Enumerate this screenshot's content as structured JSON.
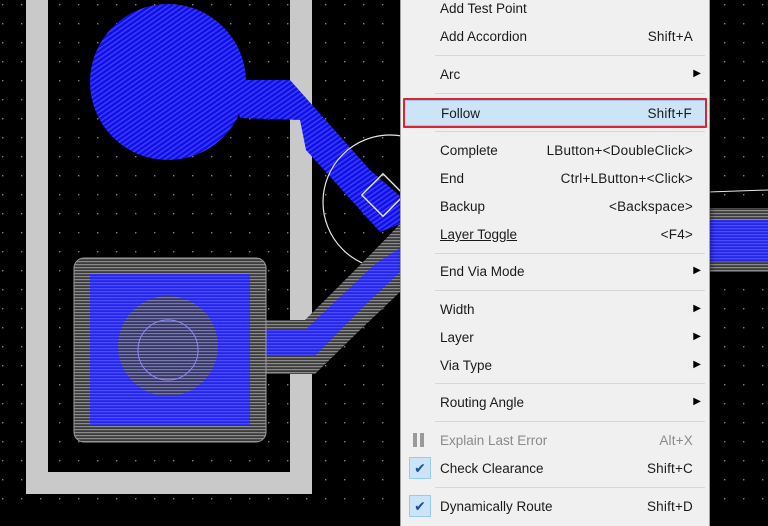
{
  "menu": {
    "items": [
      {
        "id": "add-test-point",
        "label": "Add Test Point",
        "shortcut": ""
      },
      {
        "id": "add-accordion",
        "label": "Add Accordion",
        "shortcut": "Shift+A"
      },
      {
        "id": "arc",
        "label": "Arc",
        "shortcut": "",
        "submenu": true
      },
      {
        "id": "follow",
        "label": "Follow",
        "shortcut": "Shift+F",
        "highlighted": true
      },
      {
        "id": "complete",
        "label": "Complete",
        "shortcut": "LButton+<DoubleClick>"
      },
      {
        "id": "end",
        "label": "End",
        "shortcut": "Ctrl+LButton+<Click>"
      },
      {
        "id": "backup",
        "label": "Backup",
        "shortcut": "<Backspace>"
      },
      {
        "id": "layer-toggle",
        "label": "Layer Toggle",
        "shortcut": "<F4>"
      },
      {
        "id": "end-via-mode",
        "label": "End Via Mode",
        "shortcut": "",
        "submenu": true
      },
      {
        "id": "width",
        "label": "Width",
        "shortcut": "",
        "submenu": true
      },
      {
        "id": "layer",
        "label": "Layer",
        "shortcut": "",
        "submenu": true
      },
      {
        "id": "via-type",
        "label": "Via Type",
        "shortcut": "",
        "submenu": true
      },
      {
        "id": "routing-angle",
        "label": "Routing Angle",
        "shortcut": "",
        "submenu": true
      },
      {
        "id": "explain-last-error",
        "label": "Explain Last Error",
        "shortcut": "Alt+X",
        "disabled": true
      },
      {
        "id": "check-clearance",
        "label": "Check Clearance",
        "shortcut": "Shift+C",
        "checked": true
      },
      {
        "id": "dynamically-route",
        "label": "Dynamically Route",
        "shortcut": "Shift+D",
        "checked": true
      }
    ],
    "submenu_arrow": "▶",
    "check_glyph": "✔"
  },
  "colors": {
    "canvas_bg": "#000000",
    "grid_dot": "#7f7f7f",
    "copper_blue": "#1a1aff",
    "board_outline": "#c8c8c8",
    "highlight_border": "#e0232e"
  }
}
